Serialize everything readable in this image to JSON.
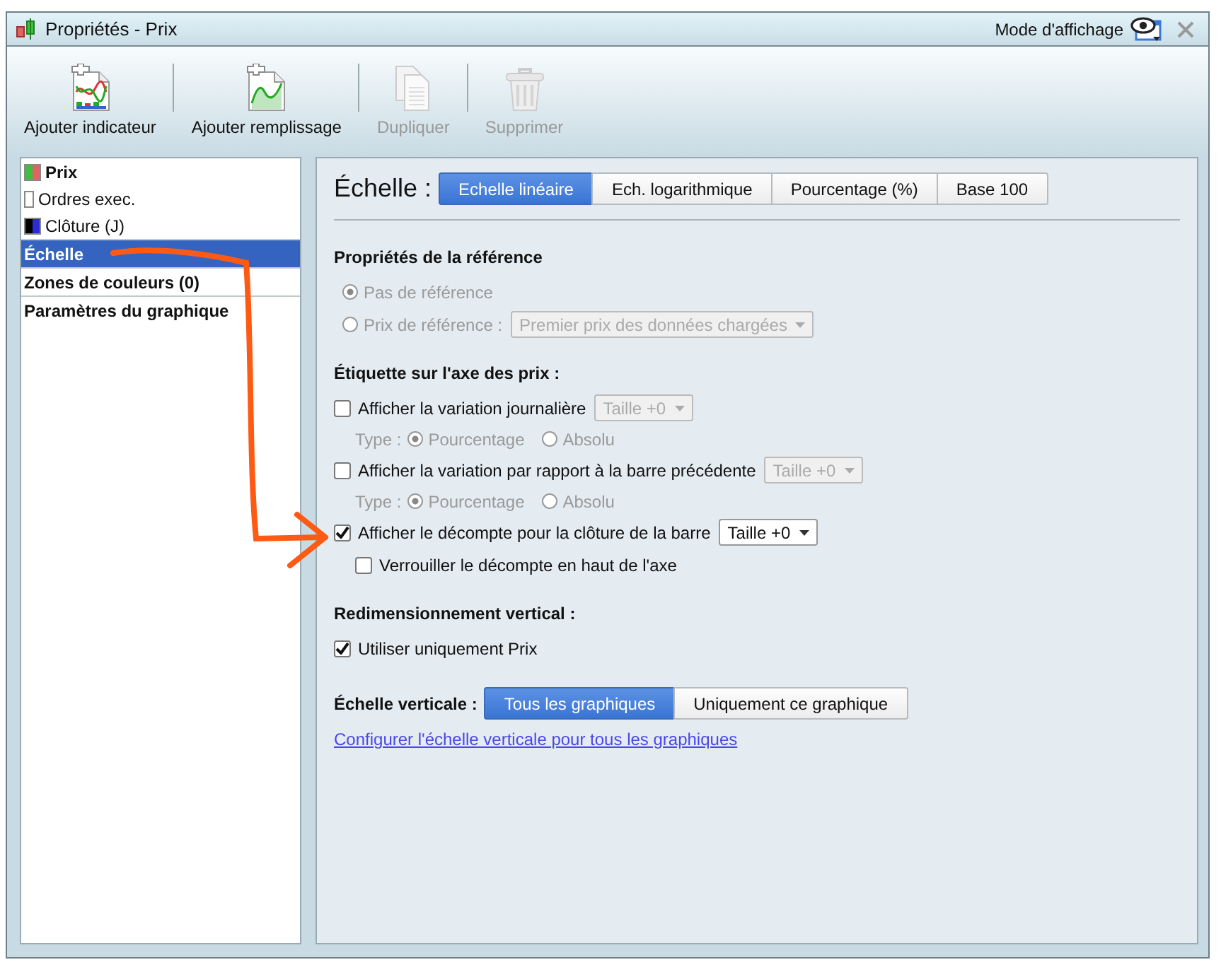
{
  "window": {
    "title": "Propriétés - Prix",
    "view_mode_label": "Mode d'affichage"
  },
  "toolbar": [
    {
      "kind": "indicator",
      "label": "Ajouter indicateur",
      "disabled": false
    },
    {
      "kind": "fill",
      "label": "Ajouter remplissage",
      "disabled": false
    },
    {
      "kind": "duplicate",
      "label": "Dupliquer",
      "disabled": true
    },
    {
      "kind": "delete",
      "label": "Supprimer",
      "disabled": true
    }
  ],
  "sidebar": {
    "items": [
      {
        "label": "Prix",
        "selected": false,
        "swatch": [
          {
            "color": "#3fbf3f"
          },
          {
            "color": "#e06464"
          }
        ],
        "children": [
          {
            "label": "Ordres exec.",
            "selected": false,
            "swatch": [
              {
                "color": "#ffffff"
              }
            ]
          },
          {
            "label": "Clôture (J)",
            "selected": false,
            "swatch": [
              {
                "color": "#000000"
              },
              {
                "color": "#2b2bd9"
              }
            ]
          }
        ]
      },
      {
        "label": "Échelle",
        "selected": true
      },
      {
        "label": "Zones de couleurs (0)",
        "selected": false
      },
      {
        "label": "Paramètres du graphique",
        "selected": false
      }
    ]
  },
  "scale": {
    "title": "Échelle :",
    "tabs": [
      {
        "label": "Echelle linéaire",
        "selected": true
      },
      {
        "label": "Ech. logarithmique",
        "selected": false
      },
      {
        "label": "Pourcentage (%)",
        "selected": false
      },
      {
        "label": "Base 100",
        "selected": false
      }
    ]
  },
  "reference": {
    "heading": "Propriétés de la référence",
    "disabled": true,
    "radios": [
      {
        "label": "Pas de référence",
        "selected": true
      },
      {
        "label": "Prix de référence :",
        "selected": false
      }
    ],
    "dropdown": "Premier prix des données chargées"
  },
  "price_label": {
    "heading": "Étiquette sur l'axe des prix :",
    "options": [
      {
        "label": "Afficher la variation journalière",
        "checked": false,
        "size": "Taille +0",
        "type_row": {
          "label": "Type :",
          "radios": [
            {
              "label": "Pourcentage",
              "selected": true
            },
            {
              "label": "Absolu",
              "selected": false
            }
          ]
        }
      },
      {
        "label": "Afficher la variation par rapport à la barre précédente",
        "checked": false,
        "size": "Taille +0",
        "type_row": {
          "label": "Type :",
          "radios": [
            {
              "label": "Pourcentage",
              "selected": true
            },
            {
              "label": "Absolu",
              "selected": false
            }
          ]
        }
      },
      {
        "label": "Afficher le décompte pour la clôture de la barre",
        "checked": true,
        "size": "Taille +0",
        "sub_option": {
          "label": "Verrouiller le décompte en haut de l'axe",
          "checked": false
        }
      }
    ]
  },
  "resize": {
    "heading": "Redimensionnement vertical :",
    "checkbox": {
      "label": "Utiliser uniquement Prix",
      "checked": true
    }
  },
  "vertical_scale": {
    "label": "Échelle verticale :",
    "segments": [
      {
        "label": "Tous les graphiques",
        "selected": true
      },
      {
        "label": "Uniquement ce graphique",
        "selected": false
      }
    ],
    "link": "Configurer l'échelle verticale pour tous les graphiques"
  }
}
